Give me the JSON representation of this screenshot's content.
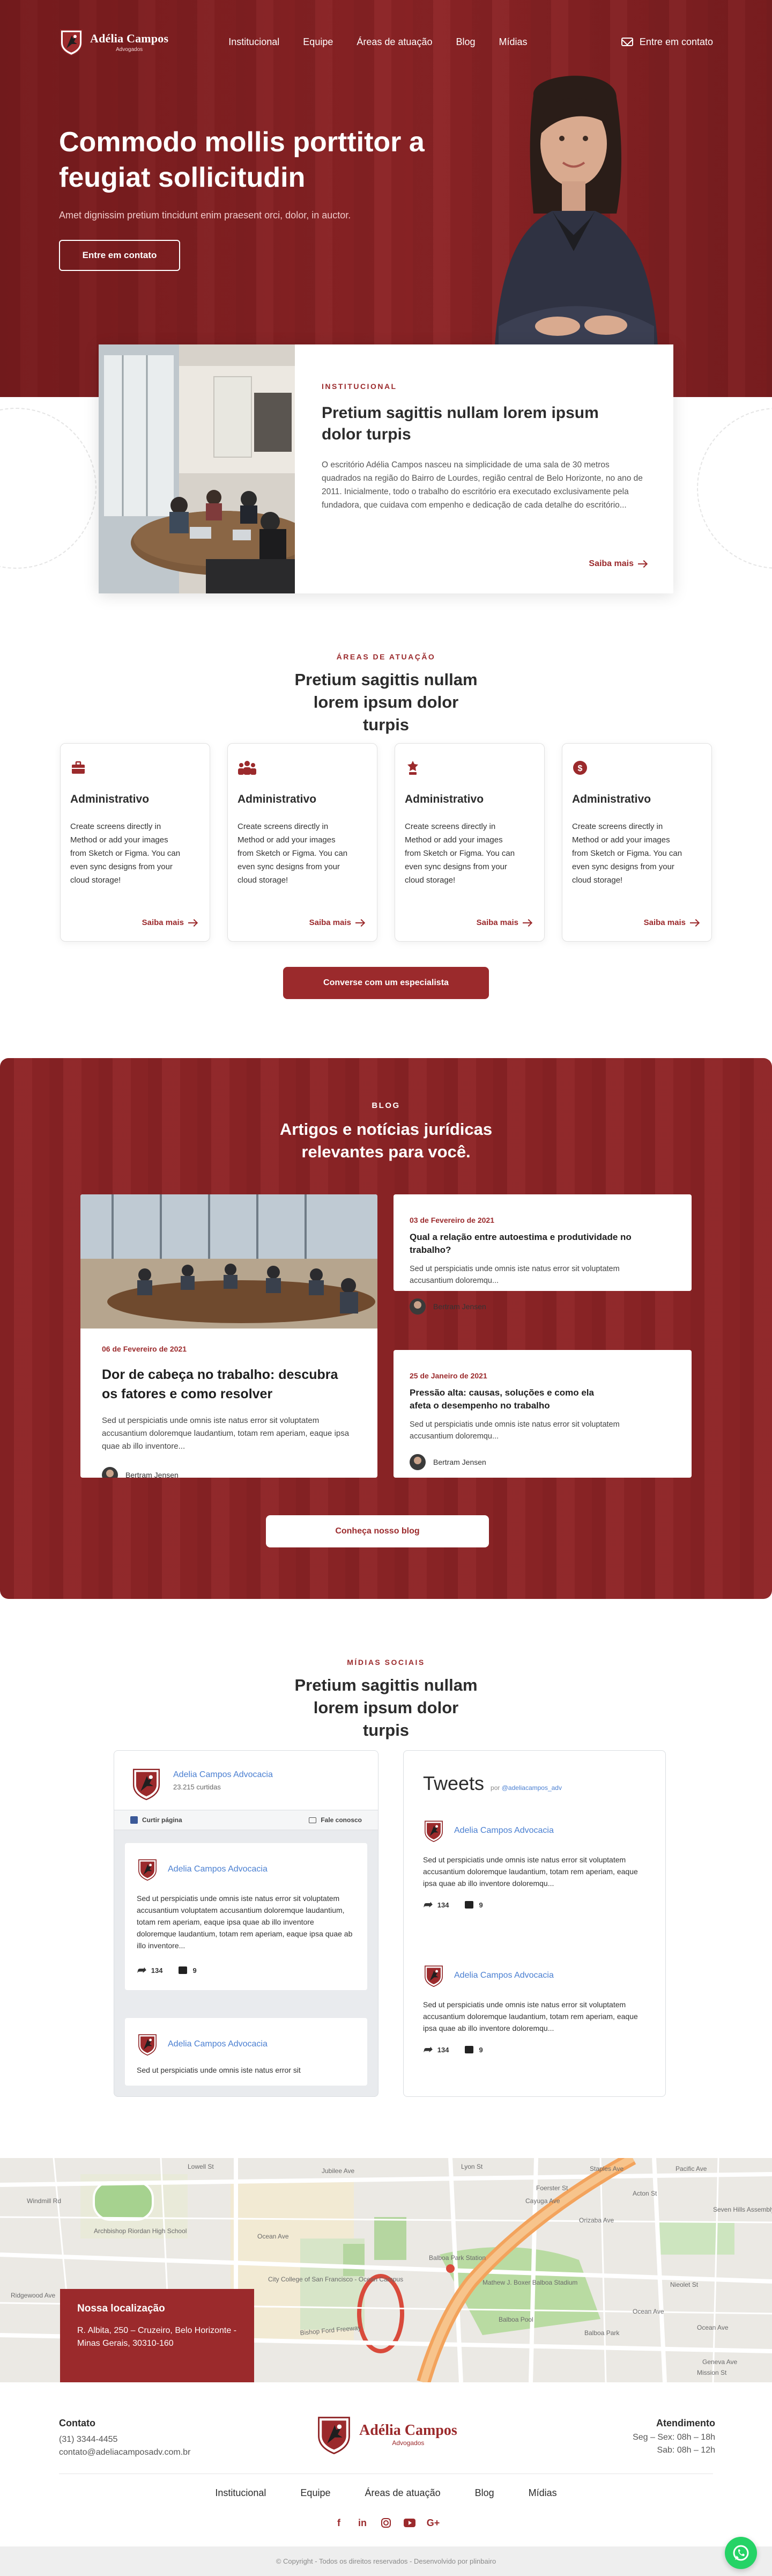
{
  "brand": {
    "name": "Adélia Campos",
    "subtitle": "Advogados"
  },
  "nav": {
    "items": [
      "Institucional",
      "Equipe",
      "Áreas de atuação",
      "Blog",
      "Mídias"
    ],
    "contact_label": "Entre em contato"
  },
  "hero": {
    "title": "Commodo mollis porttitor a feugiat sollicitudin",
    "subtitle": "Amet dignissim pretium tincidunt enim praesent orci, dolor, in auctor.",
    "cta": "Entre em contato"
  },
  "institucional": {
    "eyebrow": "INSTITUCIONAL",
    "title": "Pretium sagittis nullam lorem ipsum dolor turpis",
    "text": "O escritório Adélia Campos nasceu na simplicidade de uma sala de 30 metros quadrados na região do Bairro de Lourdes, região central de Belo Horizonte, no ano de 2011. Inicialmente, todo o trabalho do escritório era executado exclusivamente pela fundadora, que cuidava com empenho e dedicação de cada detalhe do escritório...",
    "more": "Saiba mais"
  },
  "areas": {
    "eyebrow": "ÁREAS DE ATUAÇÃO",
    "title": "Pretium sagittis nullam lorem ipsum dolor turpis",
    "cards": [
      {
        "icon": "briefcase-icon",
        "title": "Administrativo",
        "text": "Create screens directly in Method or add your images from Sketch or Figma. You can even sync designs from your cloud storage!",
        "more": "Saiba mais"
      },
      {
        "icon": "people-icon",
        "title": "Administrativo",
        "text": "Create screens directly in Method or add your images from Sketch or Figma. You can even sync designs from your cloud storage!",
        "more": "Saiba mais"
      },
      {
        "icon": "award-icon",
        "title": "Administrativo",
        "text": "Create screens directly in Method or add your images from Sketch or Figma. You can even sync designs from your cloud storage!",
        "more": "Saiba mais"
      },
      {
        "icon": "money-icon",
        "title": "Administrativo",
        "text": "Create screens directly in Method or add your images from Sketch or Figma. You can even sync designs from your cloud storage!",
        "more": "Saiba mais"
      }
    ],
    "cta": "Converse com um especialista"
  },
  "blog": {
    "eyebrow": "BLOG",
    "title": "Artigos e notícias jurídicas relevantes para você.",
    "featured": {
      "date": "06 de Fevereiro de 2021",
      "title": "Dor de cabeça no trabalho: descubra os fatores e como resolver",
      "text": "Sed ut perspiciatis unde omnis iste natus error sit voluptatem accusantium doloremque laudantium, totam rem aperiam, eaque ipsa quae ab illo inventore...",
      "author": "Bertram Jensen"
    },
    "posts": [
      {
        "date": "03 de Fevereiro de 2021",
        "title": "Qual a relação entre autoestima e produtividade no trabalho?",
        "text": "Sed ut perspiciatis unde omnis iste natus error sit voluptatem accusantium doloremqu...",
        "author": "Bertram Jensen"
      },
      {
        "date": "25 de Janeiro de 2021",
        "title": "Pressão alta: causas, soluções e como ela afeta o desempenho no trabalho",
        "text": "Sed ut perspiciatis unde omnis iste natus error sit voluptatem accusantium doloremqu...",
        "author": "Bertram Jensen"
      }
    ],
    "cta": "Conheça nosso blog"
  },
  "social": {
    "eyebrow": "MÍDIAS SOCIAIS",
    "title": "Pretium sagittis nullam lorem ipsum dolor turpis",
    "facebook": {
      "page_name": "Adelia Campos Advocacia",
      "likes": "23.215 curtidas",
      "like_btn": "Curtir página",
      "message_btn": "Fale conosco",
      "posts": [
        {
          "name": "Adelia Campos Advocacia",
          "text": "Sed ut perspiciatis unde omnis iste natus error sit voluptatem accusantium voluptatem accusantium doloremque laudantium, totam rem aperiam, eaque ipsa quae ab illo inventore doloremque laudantium, totam rem aperiam, eaque ipsa quae ab illo inventore...",
          "shares": "134",
          "comments": "9"
        },
        {
          "name": "Adelia Campos Advocacia",
          "text": "Sed ut perspiciatis unde omnis iste natus error sit"
        }
      ]
    },
    "twitter": {
      "title": "Tweets",
      "by": "por",
      "handle": "@adeliacampos_adv",
      "items": [
        {
          "name": "Adelia Campos Advocacia",
          "text": "Sed ut perspiciatis unde omnis iste natus error sit voluptatem accusantium doloremque laudantium, totam rem aperiam, eaque ipsa quae ab illo inventore doloremqu...",
          "shares": "134",
          "comments": "9"
        },
        {
          "name": "Adelia Campos Advocacia",
          "text": "Sed ut perspiciatis unde omnis iste natus error sit voluptatem accusantium doloremque laudantium, totam rem aperiam, eaque ipsa quae ab illo inventore doloremqu...",
          "shares": "134",
          "comments": "9"
        }
      ]
    }
  },
  "location": {
    "title": "Nossa localização",
    "address": "R. Albita, 250 – Cruzeiro, Belo Horizonte - Minas Gerais, 30310-160"
  },
  "map_labels": [
    "Jubilee Ave",
    "Windmill Rd",
    "Bishop Ford Freeway",
    "City College of San Francisco - Ocean Campus",
    "Ocean Ave",
    "Ocean Ave",
    "Archbishop Riordan High School",
    "Balboa Park",
    "Mathew J. Boxer Balboa Stadium",
    "Geneva Ave",
    "Cayuga Ave",
    "Pacific Ave",
    "Lowell St",
    "Ocean Ave",
    "Lyon St",
    "Orizaba Ave",
    "Foerster St",
    "Staples Ave",
    "Ridgewood Ave",
    "Mission St",
    "Acton St",
    "Seven Hills Assembly of God",
    "Balboa Pool",
    "Balboa Park Station",
    "Nieolet St"
  ],
  "footer": {
    "contact_title": "Contato",
    "phone": "(31) 3344-4455",
    "email": "contato@adeliacamposadv.com.br",
    "hours_title": "Atendimento",
    "hours_1": "Seg – Sex:  08h – 18h",
    "hours_2": "Sab:  08h – 12h",
    "menu": [
      "Institucional",
      "Equipe",
      "Áreas de atuação",
      "Blog",
      "Mídias"
    ],
    "socials": [
      "facebook-icon",
      "linkedin-icon",
      "instagram-icon",
      "youtube-icon",
      "google-plus-icon"
    ],
    "copyright": "© Copyright - Todos os direitos reservados - Desenvolvido por plinbairo"
  },
  "colors": {
    "brand_red": "#9b2a2c",
    "hero_bg": "#8e2426",
    "link_blue": "#4a7fd1",
    "whatsapp": "#25d366"
  }
}
